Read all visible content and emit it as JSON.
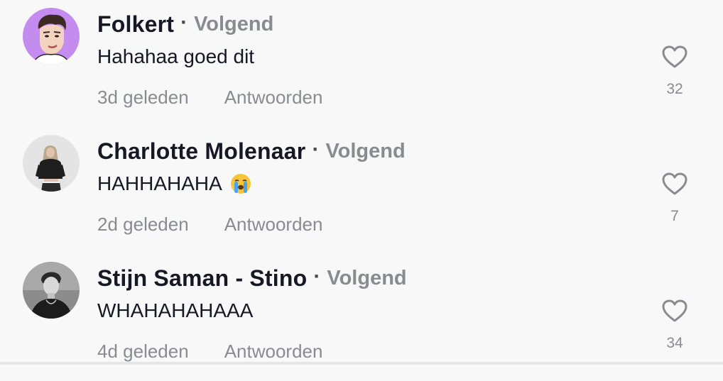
{
  "colors": {
    "background": "#f8f8f8",
    "text_primary": "#161823",
    "text_secondary": "#8a8b91",
    "avatar_folkert_bg": "#c58cf0"
  },
  "icons": {
    "like": "heart-outline-icon",
    "emoji": "loudly-crying-face-emoji"
  },
  "comments": [
    {
      "username": "Folkert",
      "separator": "·",
      "follow_status": "Volgend",
      "text": "Hahahaa goed dit",
      "timestamp": "3d geleden",
      "reply_label": "Antwoorden",
      "like_count": "32"
    },
    {
      "username": "Charlotte Molenaar",
      "separator": "·",
      "follow_status": "Volgend",
      "text": "HAHHAHAHA",
      "emoji": "😭",
      "timestamp": "2d geleden",
      "reply_label": "Antwoorden",
      "like_count": "7"
    },
    {
      "username": "Stijn Saman - Stino",
      "separator": "·",
      "follow_status": "Volgend",
      "text": "WHAHAHAHAAA",
      "timestamp": "4d geleden",
      "reply_label": "Antwoorden",
      "like_count": "34"
    }
  ]
}
